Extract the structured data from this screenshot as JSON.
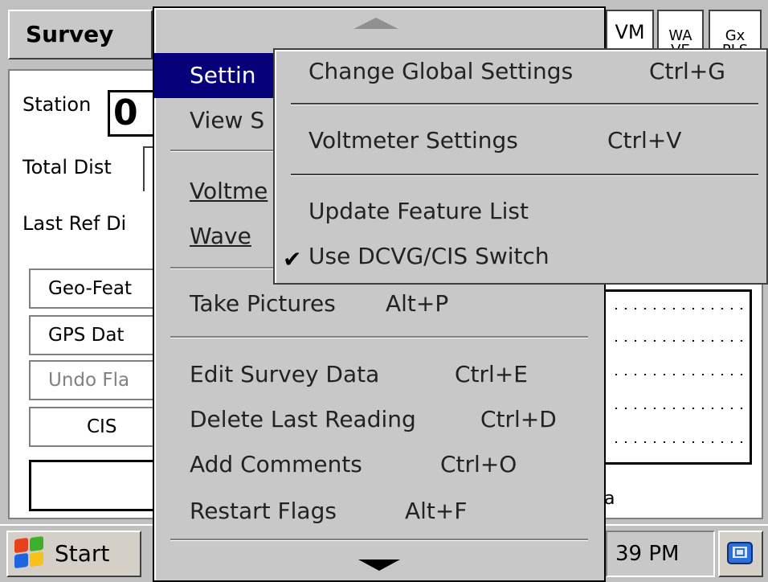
{
  "window": {
    "title_tab": "Survey",
    "toolbar_buttons": {
      "vm": "VM",
      "wave": "WA\nVE",
      "gx": "Gx\nPLS"
    }
  },
  "app": {
    "station_label": "Station",
    "station_value": "0",
    "total_dist_label": "Total Dist",
    "last_ref_label": "Last Ref Di",
    "buttons": [
      {
        "label": "Geo-Feat",
        "enabled": true
      },
      {
        "label": "GPS Dat",
        "enabled": true
      },
      {
        "label": "Undo Fla",
        "enabled": false
      },
      {
        "label": "CIS",
        "enabled": true
      }
    ],
    "partial_text": "a"
  },
  "menu": {
    "items": [
      {
        "label": "Settin",
        "highlighted": true,
        "has_submenu": true
      },
      {
        "label": "View S"
      },
      {
        "label": "Voltme",
        "mnemonic": "V"
      },
      {
        "label": "Wave",
        "mnemonic": "W"
      },
      {
        "label": "Take Pictures",
        "mnemonic": "P",
        "shortcut": "Alt+P"
      },
      {
        "label": "Edit Survey Data",
        "mnemonic": "E",
        "shortcut": "Ctrl+E"
      },
      {
        "label": "Delete Last Reading",
        "shortcut": "Ctrl+D"
      },
      {
        "label": "Add Comments",
        "mnemonic": "A",
        "shortcut": "Ctrl+O"
      },
      {
        "label": "Restart Flags",
        "mnemonic": "F",
        "shortcut": "Alt+F"
      }
    ]
  },
  "submenu": {
    "items": [
      {
        "label": "Change Global Settings",
        "shortcut": "Ctrl+G"
      },
      {
        "label": "Voltmeter Settings",
        "shortcut": "Ctrl+V"
      },
      {
        "label": "Update Feature List",
        "shortcut": ""
      },
      {
        "label": "Use DCVG/CIS Switch",
        "checked": true
      }
    ],
    "check_glyph": "✔"
  },
  "taskbar": {
    "start_label": "Start",
    "clock": "39 PM"
  }
}
